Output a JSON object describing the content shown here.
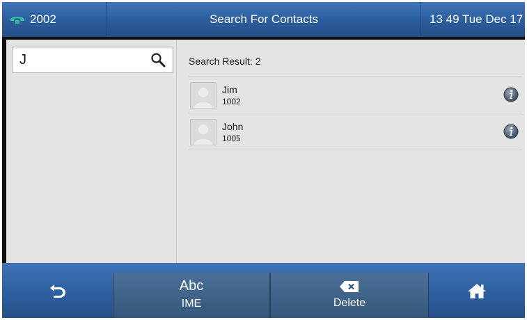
{
  "status_bar": {
    "account": "2002",
    "title": "Search For Contacts",
    "clock": "13 49 Tue Dec 17"
  },
  "search": {
    "value": "J"
  },
  "results": {
    "summary": "Search Result: 2",
    "contacts": [
      {
        "name": "Jim",
        "number": "1002"
      },
      {
        "name": "John",
        "number": "1005"
      }
    ]
  },
  "softkeys": {
    "ime_top": "Abc",
    "ime_label": "IME",
    "delete_label": "Delete"
  },
  "icons": {
    "status": "phone-icon",
    "search": "search-icon",
    "info": "info-icon",
    "back": "back-arrow-icon",
    "delete": "backspace-icon",
    "home": "home-icon"
  },
  "colors": {
    "bar_blue": "#2b5d9c",
    "phone_green": "#2fc59b",
    "content_gray": "#e4e4e4"
  }
}
